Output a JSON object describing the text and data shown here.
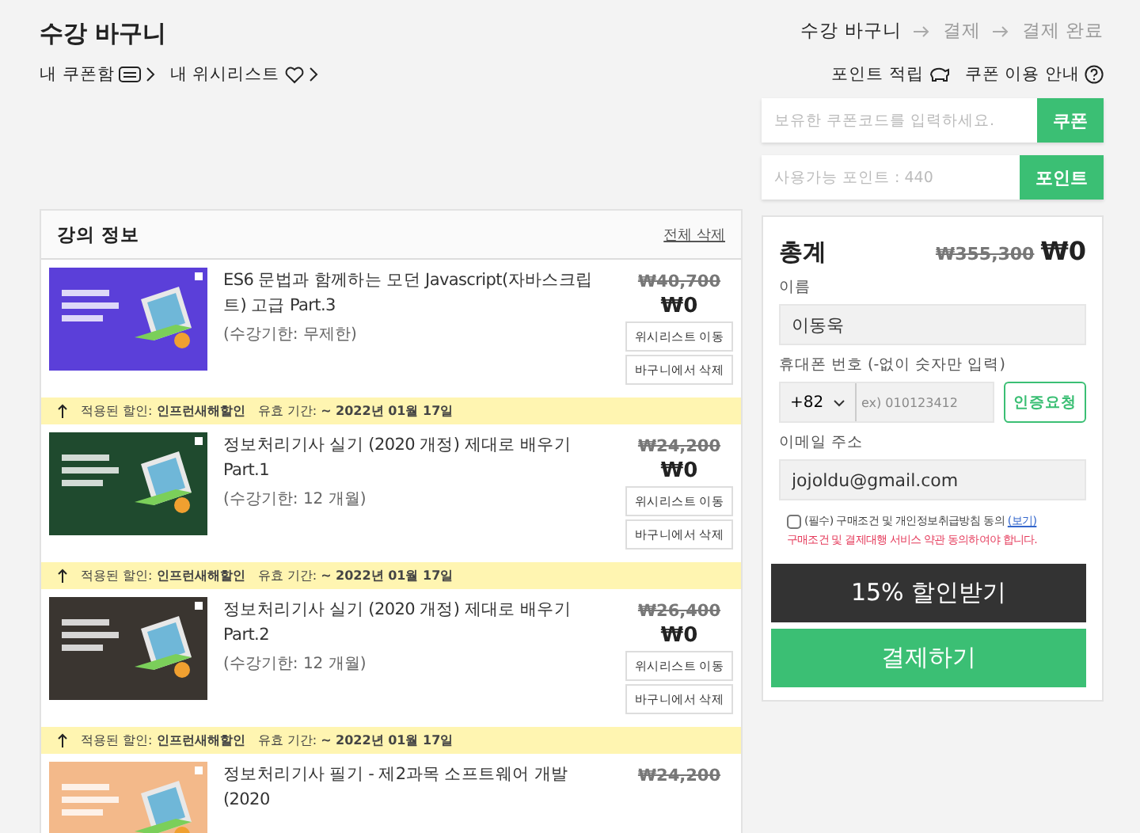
{
  "page_title": "수강 바구니",
  "steps": [
    {
      "label": "수강 바구니",
      "selected": true
    },
    {
      "label": "결제",
      "selected": false
    },
    {
      "label": "결제 완료",
      "selected": false
    }
  ],
  "my_links": [
    {
      "label": "내 쿠폰함",
      "kind": "coupon"
    },
    {
      "label": "내 위시리스트",
      "kind": "heart"
    }
  ],
  "help_links": [
    {
      "label": "포인트 적립",
      "kind": "piggy"
    },
    {
      "label": "쿠폰 이용 안내",
      "kind": "help"
    }
  ],
  "coupon": {
    "placeholder": "보유한 쿠폰코드를 입력하세요.",
    "button": "쿠폰"
  },
  "points": {
    "placeholder": "사용가능 포인트 : 440",
    "button": "포인트"
  },
  "course_list": {
    "title": "강의 정보",
    "clear": "전체 삭제"
  },
  "courses": [
    {
      "title": "ES6 문법과 함께하는 모던 Javascript(자바스크립트) 고급 Part.3",
      "period": "(수강기한: 무제한)",
      "old_price": "₩40,700",
      "price": "₩0",
      "color": "#5b3fd9",
      "buttons": [
        "위시리스트 이동",
        "바구니에서 삭제"
      ],
      "discount": {
        "label": "적용된 할인: **인프런새해할인**",
        "period": "유효 기간: **~ 2022년 01월 17일**"
      }
    },
    {
      "title": "정보처리기사 실기 (2020 개정) 제대로 배우기 Part.1",
      "period": "(수강기한: 12 개월)",
      "old_price": "₩24,200",
      "price": "₩0",
      "color": "#1f4a2e",
      "buttons": [
        "위시리스트 이동",
        "바구니에서 삭제"
      ],
      "discount": {
        "label": "적용된 할인: **인프런새해할인**",
        "period": "유효 기간: **~ 2022년 01월 17일**"
      }
    },
    {
      "title": "정보처리기사 실기 (2020 개정) 제대로 배우기 Part.2",
      "period": "(수강기한: 12 개월)",
      "old_price": "₩26,400",
      "price": "₩0",
      "color": "#3a3530",
      "buttons": [
        "위시리스트 이동",
        "바구니에서 삭제"
      ],
      "discount": {
        "label": "적용된 할인: **인프런새해할인**",
        "period": "유효 기간: **~ 2022년 01월 17일**"
      }
    },
    {
      "title": "정보처리기사 필기 - 제2과목 소프트웨어 개발 (2020",
      "old_price": "₩24,200",
      "color": "#f3b98a"
    }
  ],
  "summary": {
    "title": "총계",
    "old_total": "₩355,300",
    "total": "₩0",
    "name": {
      "label": "이름",
      "value": "이동욱"
    },
    "phone": {
      "label": "휴대폰 번호 (-없이 숫자만 입력)",
      "country": "+82",
      "placeholder": "ex) 010123412",
      "button": "인증요청"
    },
    "email": {
      "label": "이메일 주소",
      "value": "jojoldu@gmail.com"
    },
    "agree": {
      "checked": false,
      "text": "(필수) 구매조건 및 개인정보취급방침 동의",
      "link": "(보기)",
      "warning": "구매조건 및 결제대행 서비스 약관 동의하여야 합니다."
    },
    "discount_button": "15% 할인받기",
    "pay_button": "결제하기"
  }
}
